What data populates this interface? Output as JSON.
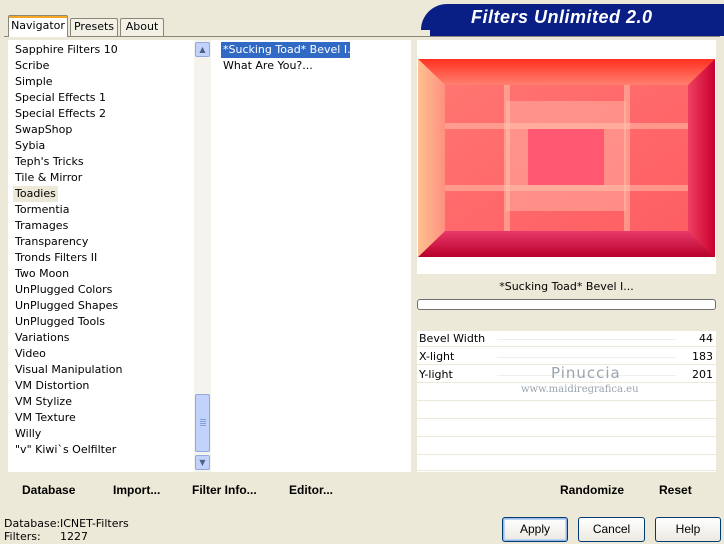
{
  "banner": {
    "title": "Filters Unlimited 2.0"
  },
  "tabs": [
    {
      "label": "Navigator",
      "active": true
    },
    {
      "label": "Presets",
      "active": false
    },
    {
      "label": "About",
      "active": false
    }
  ],
  "categories": [
    "Sapphire Filters 10",
    "Scribe",
    "Simple",
    "Special Effects 1",
    "Special Effects 2",
    "SwapShop",
    "Sybia",
    "Teph's Tricks",
    "Tile & Mirror",
    "Toadies",
    "Tormentia",
    "Tramages",
    "Transparency",
    "Tronds Filters II",
    "Two Moon",
    "UnPlugged Colors",
    "UnPlugged Shapes",
    "UnPlugged Tools",
    "Variations",
    "Video",
    "Visual Manipulation",
    "VM Distortion",
    "VM Stylize",
    "VM Texture",
    "Willy",
    "\"v\" Kiwi`s Oelfilter"
  ],
  "selected_category": "Toadies",
  "filters": [
    {
      "label": "*Sucking Toad*  Bevel I...",
      "selected": true
    },
    {
      "label": "What Are You?...",
      "selected": false
    }
  ],
  "preview": {
    "filter_name": "*Sucking Toad*  Bevel I...",
    "progress": 0
  },
  "params": [
    {
      "name": "Bevel Width",
      "value": "44"
    },
    {
      "name": "X-light",
      "value": "183"
    },
    {
      "name": "Y-light",
      "value": "201"
    }
  ],
  "watermark": {
    "line1": "Pinuccia",
    "line2": "www.maidiregrafica.eu"
  },
  "toolbar_left": {
    "database": "Database",
    "import": "Import...",
    "filter_info": "Filter Info...",
    "editor": "Editor..."
  },
  "toolbar_right": {
    "randomize": "Randomize",
    "reset": "Reset"
  },
  "status": {
    "database_label": "Database:",
    "database_value": "ICNET-Filters",
    "filters_label": "Filters:",
    "filters_value": "1227"
  },
  "buttons": {
    "apply": "Apply",
    "cancel": "Cancel",
    "help": "Help"
  },
  "colors": {
    "banner": "#0a1f86",
    "selection": "#316ac5",
    "face": "#ece9d8"
  }
}
